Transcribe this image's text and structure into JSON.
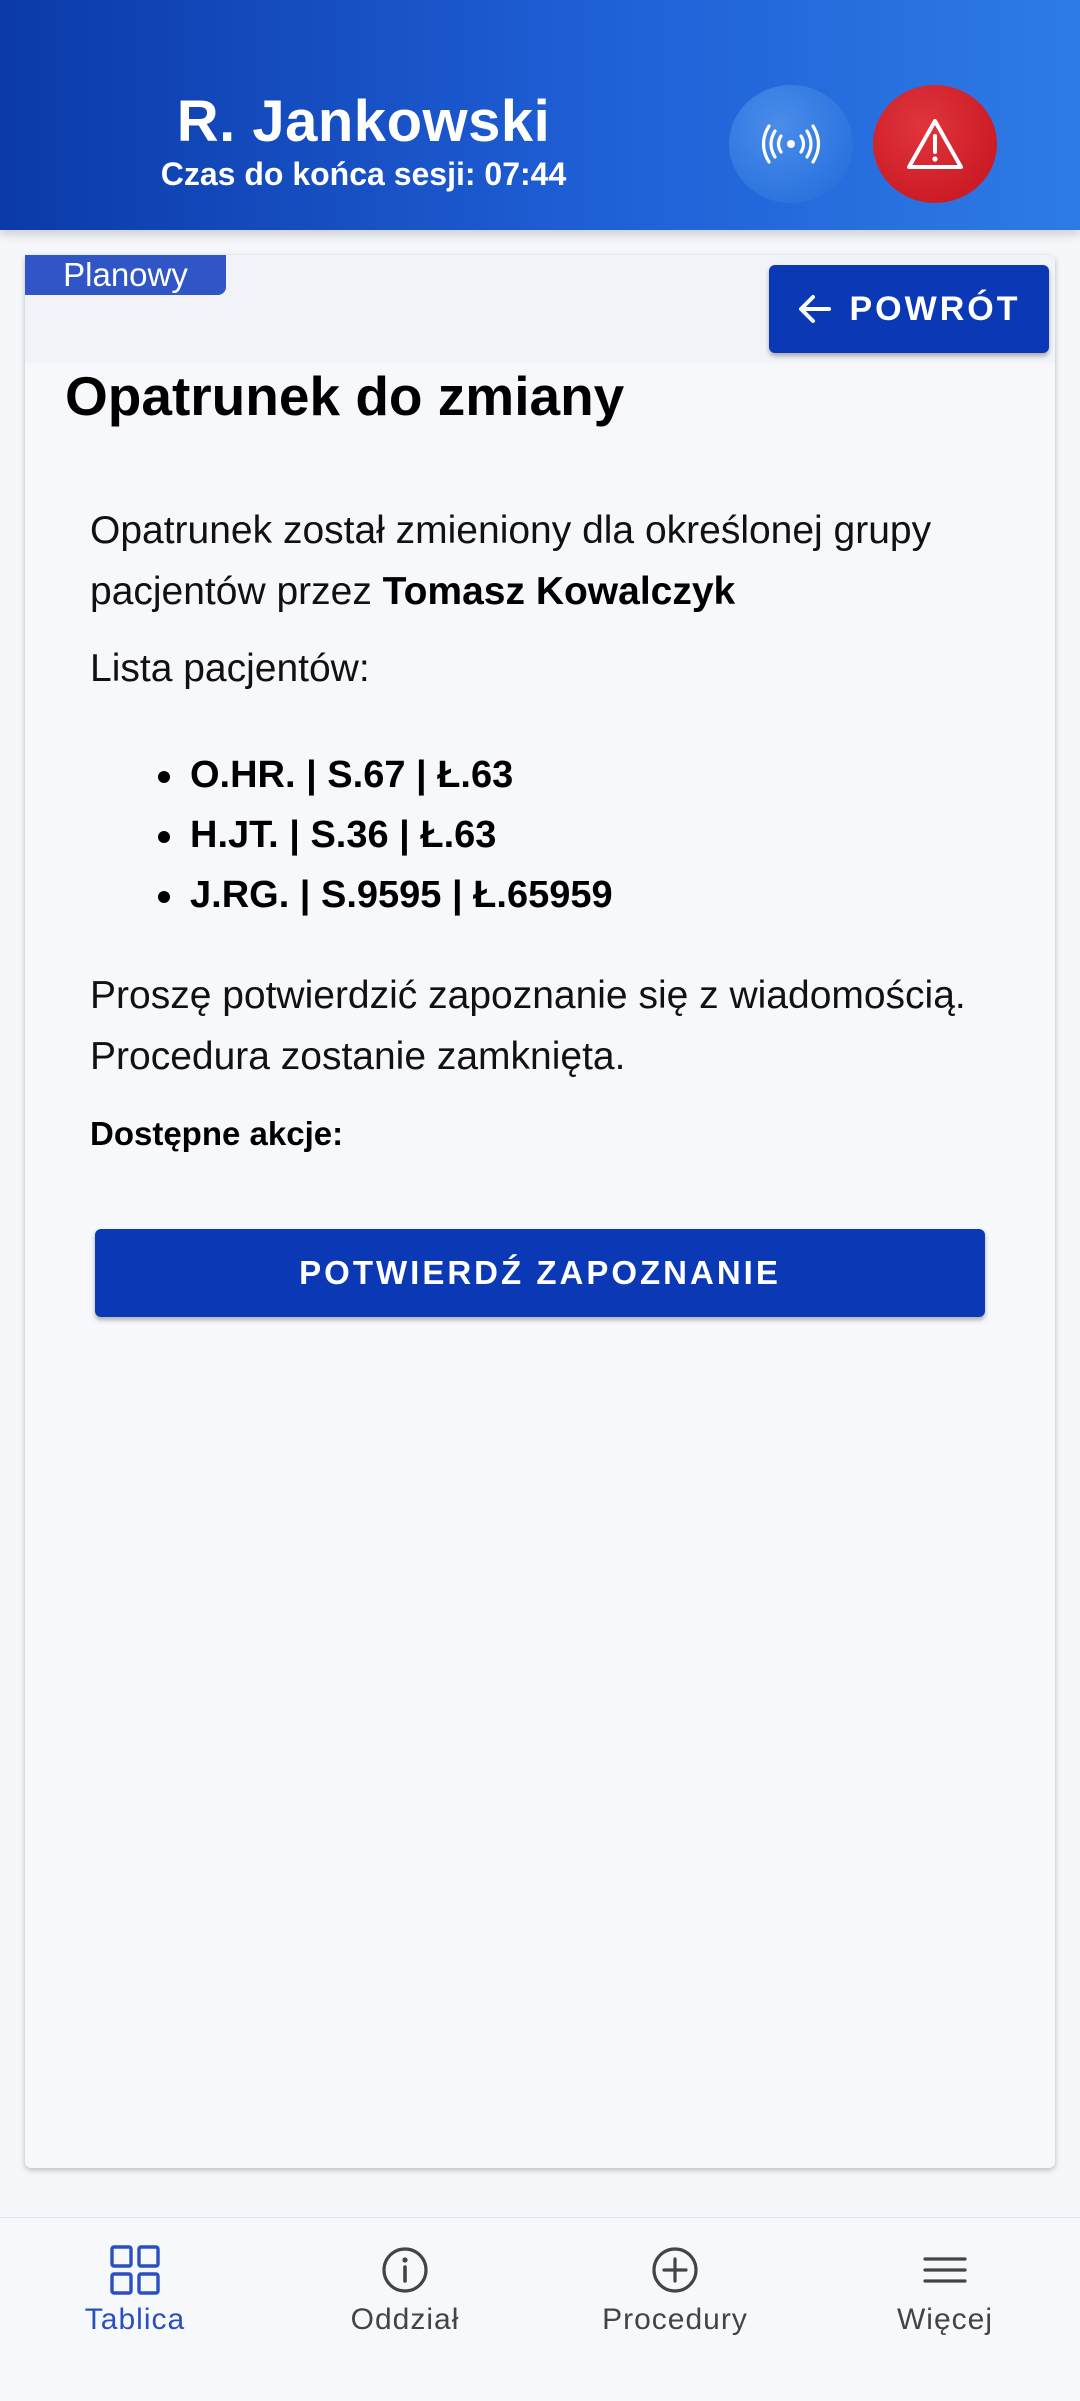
{
  "header": {
    "user_name": "R. Jankowski",
    "session_text": "Czas do końca sesji: 07:44",
    "signal_icon": "broadcast-signal-icon",
    "alert_icon": "warning-triangle-icon"
  },
  "card": {
    "badge": "Planowy",
    "back_button": "POWRÓT",
    "title": "Opatrunek do zmiany",
    "message_prefix": "Opatrunek został zmieniony dla określonej grupy pacjentów przez",
    "message_author": "Tomasz Kowalczyk",
    "list_label": "Lista pacjentów:",
    "patients": [
      "O.HR. | S.67 | Ł.63",
      "H.JT. | S.36 | Ł.63",
      "J.RG. | S.9595 | Ł.65959"
    ],
    "confirm_text": "Proszę potwierdzić zapoznanie się z wiadomością. Procedura zostanie zamknięta.",
    "actions_label": "Dostępne akcje:",
    "confirm_button": "POTWIERDŹ ZAPOZNANIE"
  },
  "bottom_nav": {
    "items": [
      {
        "label": "Tablica",
        "icon": "grid-icon",
        "active": true
      },
      {
        "label": "Oddział",
        "icon": "info-icon",
        "active": false
      },
      {
        "label": "Procedury",
        "icon": "plus-circle-icon",
        "active": false
      },
      {
        "label": "Więcej",
        "icon": "menu-icon",
        "active": false
      }
    ]
  },
  "colors": {
    "primary": "#0b39b5",
    "header_start": "#0b3aa8",
    "header_end": "#2d7be6",
    "alert": "#cc1d27",
    "nav_active": "#2a4fc0",
    "nav_inactive": "#444444"
  }
}
